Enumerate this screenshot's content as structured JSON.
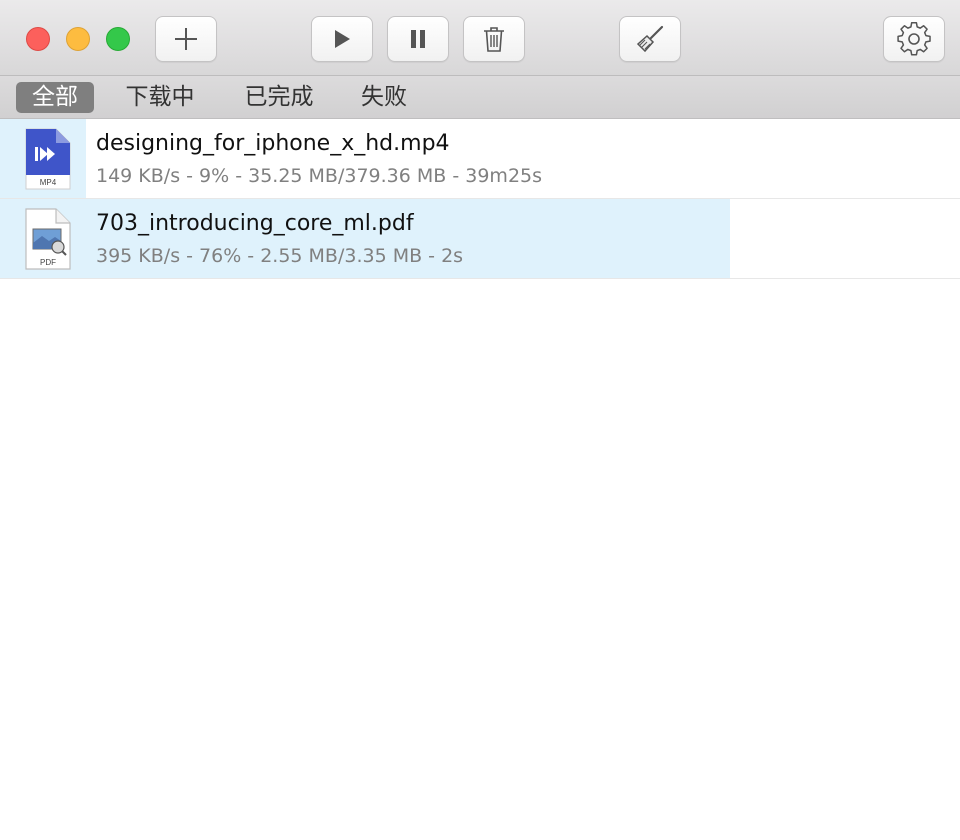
{
  "toolbar": {
    "buttons": [
      {
        "id": "add",
        "icon": "plus-icon"
      },
      {
        "id": "start",
        "icon": "play-icon"
      },
      {
        "id": "pause",
        "icon": "pause-icon"
      },
      {
        "id": "delete",
        "icon": "trash-icon"
      },
      {
        "id": "clean",
        "icon": "broom-icon"
      },
      {
        "id": "settings",
        "icon": "gear-icon"
      }
    ]
  },
  "filter": {
    "tabs": [
      {
        "label": "全部",
        "active": true
      },
      {
        "label": "下载中",
        "active": false
      },
      {
        "label": "已完成",
        "active": false
      },
      {
        "label": "失败",
        "active": false
      }
    ]
  },
  "downloads": [
    {
      "name": "designing_for_iphone_x_hd.mp4",
      "stats": "149 KB/s - 9% - 35.25 MB/379.36 MB - 39m25s",
      "progress": 0.09,
      "icon": "mp4-file-icon",
      "icon_label": "MP4"
    },
    {
      "name": "703_introducing_core_ml.pdf",
      "stats": "395 KB/s - 76% - 2.55 MB/3.35 MB - 2s",
      "progress": 0.76,
      "icon": "pdf-file-icon",
      "icon_label": "PDF"
    }
  ],
  "colors": {
    "progress_fill": "#dff2fc",
    "active_tab": "#7f7f7f",
    "close": "#fc605c",
    "minimize": "#fdbc40",
    "maximize": "#34c84a"
  }
}
